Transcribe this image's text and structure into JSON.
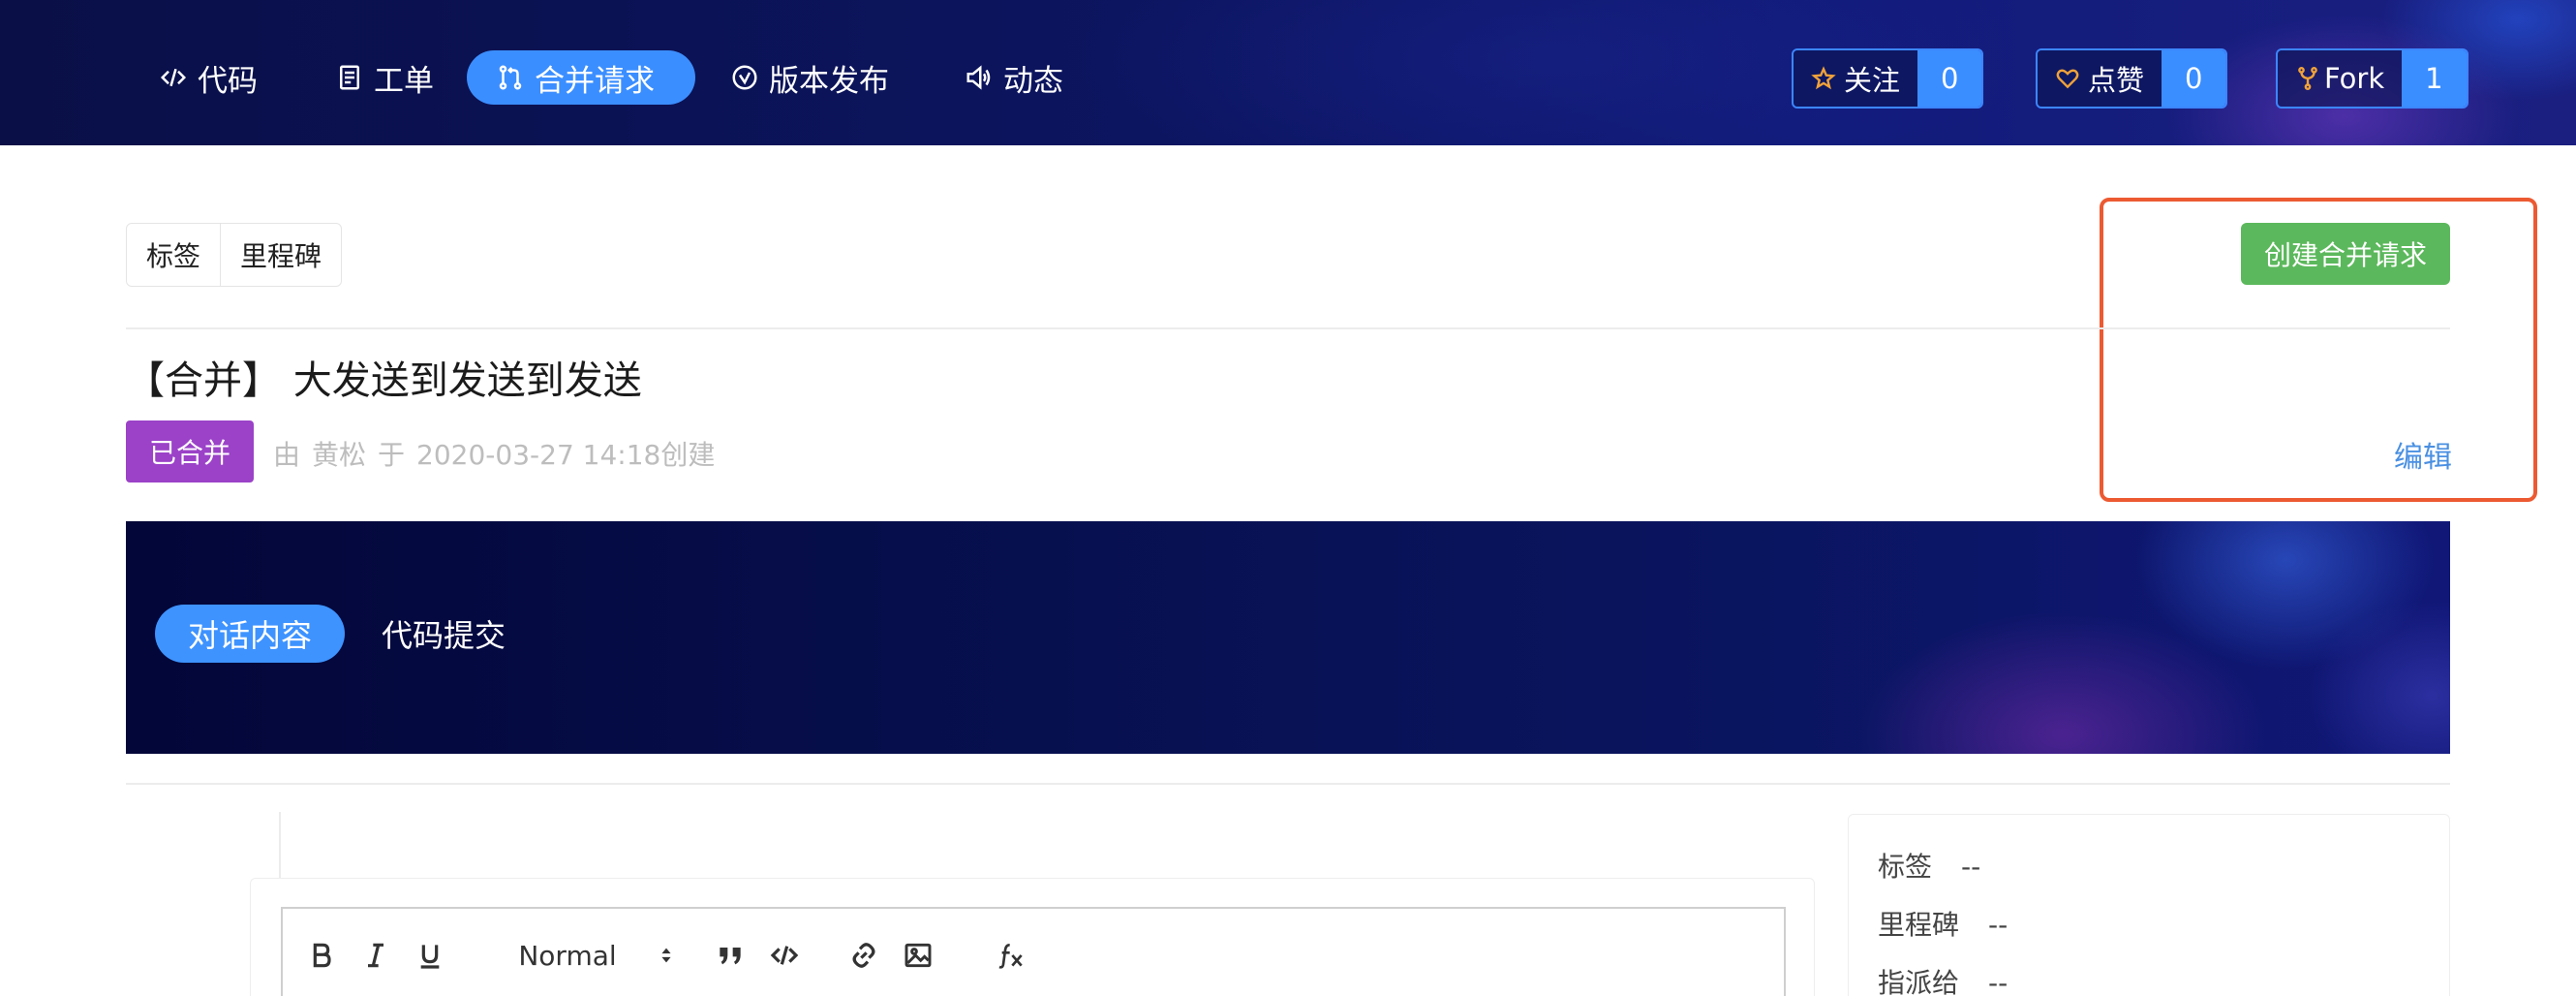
{
  "nav": {
    "items": [
      {
        "label": "代码",
        "icon": "code-icon"
      },
      {
        "label": "工单",
        "icon": "clipboard-icon"
      },
      {
        "label": "合并请求",
        "icon": "merge-request-icon"
      },
      {
        "label": "版本发布",
        "icon": "check-circle-icon"
      },
      {
        "label": "动态",
        "icon": "speaker-icon"
      }
    ],
    "watch": {
      "label": "关注",
      "count": "0",
      "icon": "star-icon"
    },
    "like": {
      "label": "点赞",
      "count": "0",
      "icon": "heart-icon"
    },
    "fork": {
      "label": "Fork",
      "count": "1",
      "icon": "fork-icon"
    }
  },
  "filters": {
    "labels": "标签",
    "milestones": "里程碑"
  },
  "actions": {
    "create": "创建合并请求",
    "edit": "编辑"
  },
  "pr": {
    "title": "【合并】 大发送到发送到发送",
    "status": "已合并",
    "meta_by": "由",
    "author": "黄松",
    "meta_at": "于",
    "created": "2020-03-27 14:18创建"
  },
  "tabs": {
    "conversation": "对话内容",
    "commits": "代码提交"
  },
  "editor": {
    "format": "Normal"
  },
  "sidebar": {
    "label_key": "标签",
    "label_val": "--",
    "milestone_key": "里程碑",
    "milestone_val": "--",
    "assignee_key": "指派给",
    "assignee_val": "--"
  },
  "colors": {
    "accent": "#3b8eff",
    "merged": "#9b42c8",
    "create": "#5cb85c",
    "highlight": "#ec5a32",
    "link": "#4a90e2"
  }
}
